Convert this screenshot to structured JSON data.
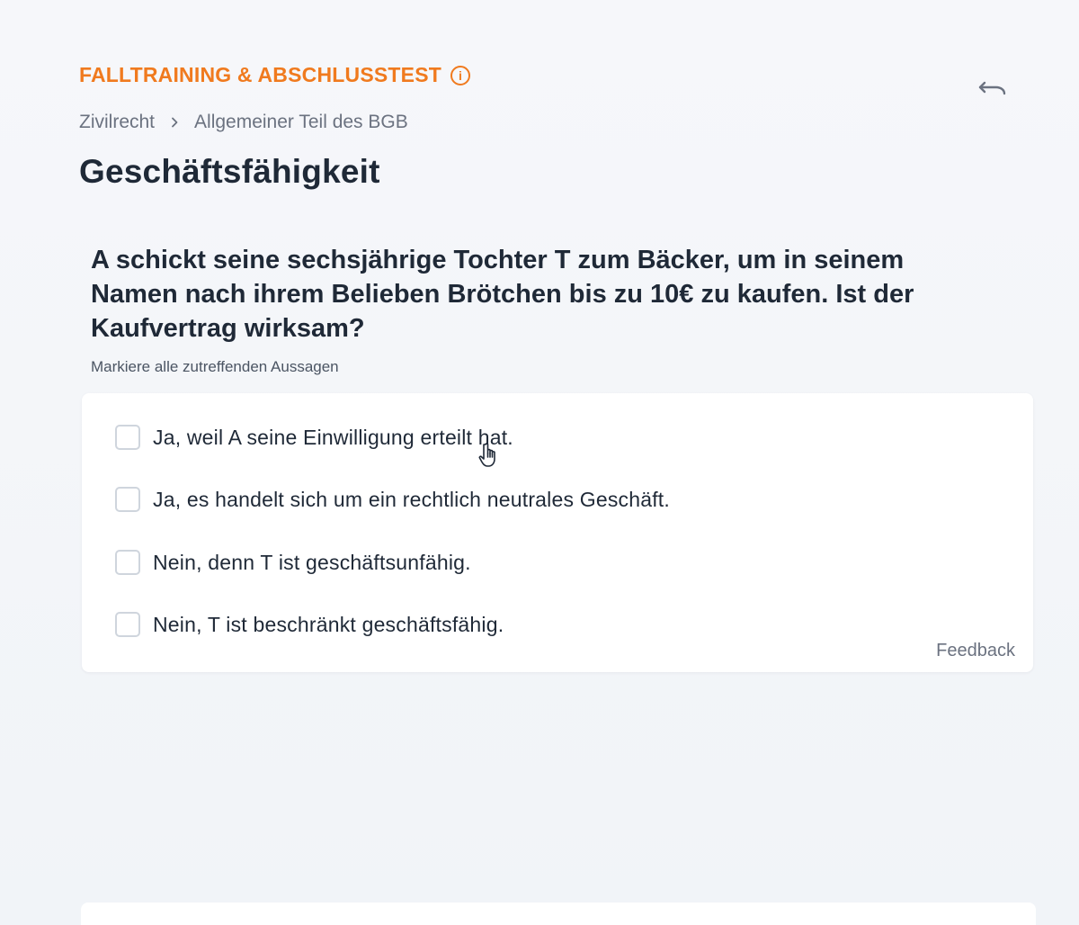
{
  "header": {
    "eyebrow": "FALLTRAINING & ABSCHLUSSTEST",
    "info_icon": "info-icon",
    "undo_icon": "undo-icon"
  },
  "breadcrumb": {
    "items": [
      "Zivilrecht",
      "Allgemeiner Teil des BGB"
    ],
    "separator_icon": "chevron-right-icon"
  },
  "page": {
    "title": "Geschäftsfähigkeit"
  },
  "question": {
    "text": "A schickt seine sechsjährige Tochter T zum Bäcker, um in seinem Namen nach ihrem Belieben Brötchen bis zu 10€ zu kaufen. Ist der Kaufvertrag wirksam?",
    "instruction": "Markiere alle zutreffenden Aussagen",
    "answers": [
      {
        "label": "Ja, weil A seine Einwilligung erteilt hat.",
        "checked": false
      },
      {
        "label": "Ja, es handelt sich um ein rechtlich neutrales Geschäft.",
        "checked": false
      },
      {
        "label": "Nein, denn T ist geschäftsunfähig.",
        "checked": false
      },
      {
        "label": "Nein, T ist beschränkt geschäftsfähig.",
        "checked": false
      }
    ],
    "feedback_label": "Feedback"
  },
  "colors": {
    "accent": "#f07a1e",
    "text": "#1f2937",
    "muted": "#6b7280",
    "card": "#ffffff",
    "background": "#f4f6f9"
  }
}
